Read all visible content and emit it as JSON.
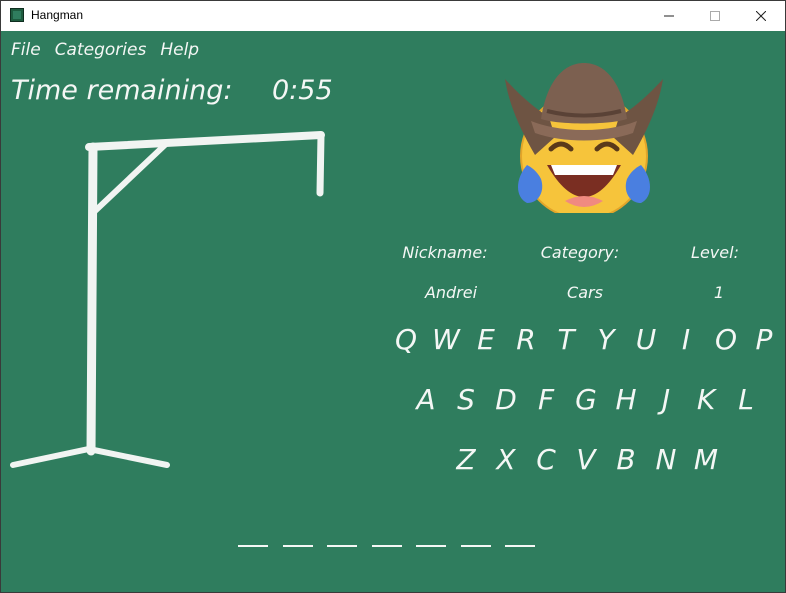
{
  "window": {
    "title": "Hangman",
    "controls": {
      "minimize": "—",
      "maximize": "☐",
      "close": "✕"
    }
  },
  "menu": [
    "File",
    "Categories",
    "Help"
  ],
  "timer": {
    "label": "Time remaining:",
    "value": "0:55"
  },
  "avatar": {
    "icon": "cowboy-laughing-emoji-icon"
  },
  "info": {
    "nickname_label": "Nickname:",
    "category_label": "Category:",
    "level_label": "Level:",
    "nickname": "Andrei",
    "category": "Cars",
    "level": "1"
  },
  "keyboard": {
    "row1": [
      "Q",
      "W",
      "E",
      "R",
      "T",
      "Y",
      "U",
      "I",
      "O",
      "P"
    ],
    "row2": [
      "A",
      "S",
      "D",
      "F",
      "G",
      "H",
      "J",
      "K",
      "L"
    ],
    "row3": [
      "Z",
      "X",
      "C",
      "V",
      "B",
      "N",
      "M"
    ]
  },
  "word": {
    "letters": [
      "",
      "",
      "",
      "",
      "",
      "",
      ""
    ]
  },
  "colors": {
    "board": "#2f7d5e",
    "chalk": "#f4f7f5"
  }
}
